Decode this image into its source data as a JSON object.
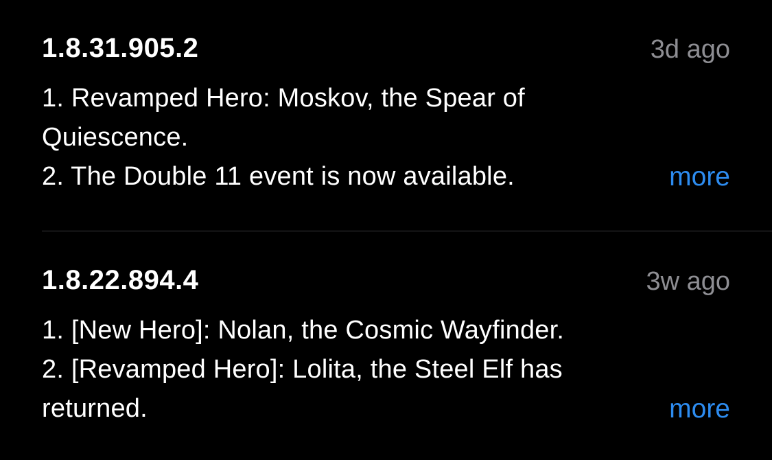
{
  "versions": [
    {
      "version": "1.8.31.905.2",
      "age": "3d ago",
      "notes": [
        "1. Revamped Hero: Moskov, the Spear of",
        "Quiescence.",
        "2. The Double 11 event is now available."
      ],
      "more_label": "more"
    },
    {
      "version": "1.8.22.894.4",
      "age": "3w ago",
      "notes": [
        "1. [New Hero]: Nolan, the Cosmic Wayfinder.",
        "2. [Revamped Hero]: Lolita, the Steel Elf has",
        "returned."
      ],
      "more_label": "more"
    }
  ],
  "colors": {
    "background": "#000000",
    "text": "#ffffff",
    "secondary_text": "#8e8e93",
    "link": "#2d8cf0",
    "separator": "#3a3a3c"
  }
}
